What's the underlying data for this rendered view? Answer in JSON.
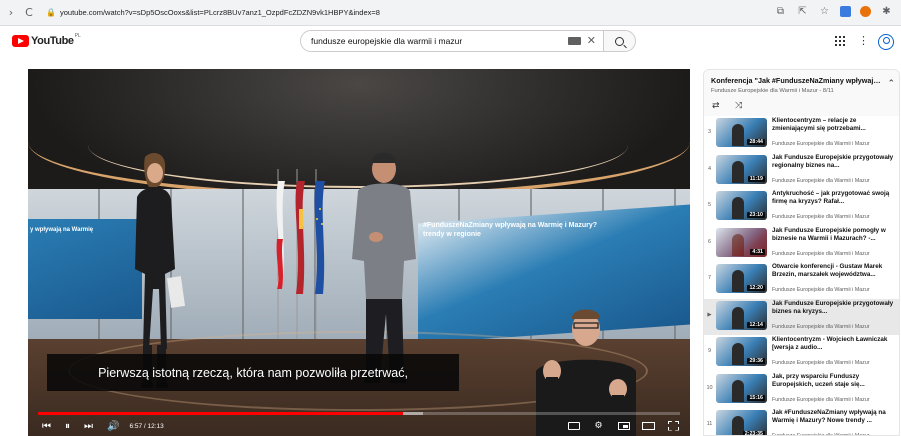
{
  "browser": {
    "back_icon": "back-arrow-icon",
    "reload_icon": "reload-icon",
    "url": "youtube.com/watch?v=sDp5OscOoxs&list=PLcrz8BUv7anz1_OzpdFcZDZN9vk1HBPY&index=8"
  },
  "header": {
    "logo_text": "YouTube",
    "logo_country": "PL",
    "search_value": "fundusze europejskie dla warmii i mazur"
  },
  "player": {
    "caption": "Pierwszą istotną rzeczą, która nam pozwoliła przetrwać,",
    "screen_left_text": "y wpływają na Warmię",
    "screen_right_line1": "#FunduszeNaZmiany wpływają na Warmię i Mazury?",
    "screen_right_line2": "trendy w regionie",
    "time": "6:57 / 12:13",
    "progress_played": 0.569,
    "progress_loaded": 0.6,
    "accent": "#ff0000"
  },
  "playlist": {
    "title": "Konferencja \"Jak #FunduszeNaZmiany wpływają n...",
    "subtitle": "Fundusze Europejskie dla Warmii i Mazur - 8/11",
    "items": [
      {
        "idx": "3",
        "title": "Klientocentryzm – relacje ze zmieniającymi się potrzebami...",
        "channel": "Fundusze Europejskie dla Warmii i Mazur",
        "duration": "28:44",
        "active": false
      },
      {
        "idx": "4",
        "title": "Jak Fundusze Europejskie przygotowały regionalny biznes na...",
        "channel": "Fundusze Europejskie dla Warmii i Mazur",
        "duration": "11:19",
        "active": false
      },
      {
        "idx": "5",
        "title": "Antykruchość – jak przygotować swoją firmę na kryzys? Rafał...",
        "channel": "Fundusze Europejskie dla Warmii i Mazur",
        "duration": "23:10",
        "active": false
      },
      {
        "idx": "6",
        "title": "Jak Fundusze Europejskie pomogły w biznesie na Warmii i Mazurach? -...",
        "channel": "Fundusze Europejskie dla Warmii i Mazur",
        "duration": "4:31",
        "active": false
      },
      {
        "idx": "7",
        "title": "Otwarcie konferencji - Gustaw Marek Brzezin, marszałek województwa...",
        "channel": "Fundusze Europejskie dla Warmii i Mazur",
        "duration": "12:20",
        "active": false
      },
      {
        "idx": "▶",
        "title": "Jak Fundusze Europejskie przygotowały biznes na kryzys...",
        "channel": "Fundusze Europejskie dla Warmii i Mazur",
        "duration": "12:14",
        "active": true
      },
      {
        "idx": "9",
        "title": "Klientocentryzm - Wojciech Ławniczak [wersja z audio...",
        "channel": "Fundusze Europejskie dla Warmii i Mazur",
        "duration": "29:36",
        "active": false
      },
      {
        "idx": "10",
        "title": "Jak, przy wsparciu Funduszy Europejskich, uczeń staje się...",
        "channel": "Fundusze Europejskie dla Warmii i Mazur",
        "duration": "15:16",
        "active": false
      },
      {
        "idx": "11",
        "title": "Jak #FunduszeNaZmiany wpływają na Warmię i Mazury? Nowe trendy ...",
        "channel": "Fundusze Europejskie dla Warmii i Mazur",
        "duration": "2:23:35",
        "active": false
      }
    ]
  }
}
